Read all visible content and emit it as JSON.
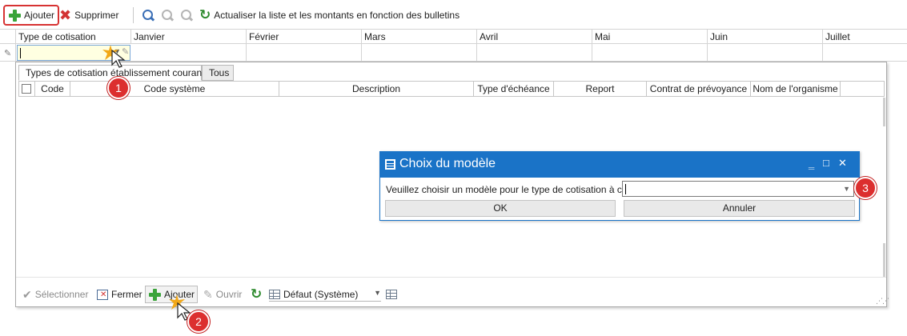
{
  "toolbar": {
    "add_label": "Ajouter",
    "delete_label": "Supprimer",
    "refresh_label": "Actualiser la liste et les montants en fonction des bulletins",
    "icons": [
      "plus-icon",
      "delete-icon",
      "search-icon",
      "zoom-in-icon",
      "zoom-out-icon",
      "refresh-icon"
    ]
  },
  "grid": {
    "columns": [
      "Type de cotisation",
      "Janvier",
      "Février",
      "Mars",
      "Avril",
      "Mai",
      "Juin",
      "Juillet"
    ]
  },
  "dropdown": {
    "tabs": [
      "Types de cotisation établissement courants",
      "Tous"
    ],
    "columns": [
      "Code",
      "Code système",
      "Description",
      "Type d'échéance",
      "Report",
      "Contrat de prévoyance",
      "Nom de l'organisme"
    ],
    "bottom": {
      "select_label": "Sélectionner",
      "close_label": "Fermer",
      "add_label": "Ajouter",
      "open_label": "Ouvrir",
      "view_value": "Défaut (Système)"
    }
  },
  "modal": {
    "title": "Choix du modèle",
    "prompt": "Veuillez choisir un modèle pour le type de cotisation à créer :",
    "input_value": "",
    "ok_label": "OK",
    "cancel_label": "Annuler"
  },
  "callouts": [
    "1",
    "2",
    "3"
  ],
  "colors": {
    "accent": "#1a73c7",
    "callout": "#dc2f2f",
    "add_green": "#3aa43a",
    "delete_red": "#d23232"
  }
}
